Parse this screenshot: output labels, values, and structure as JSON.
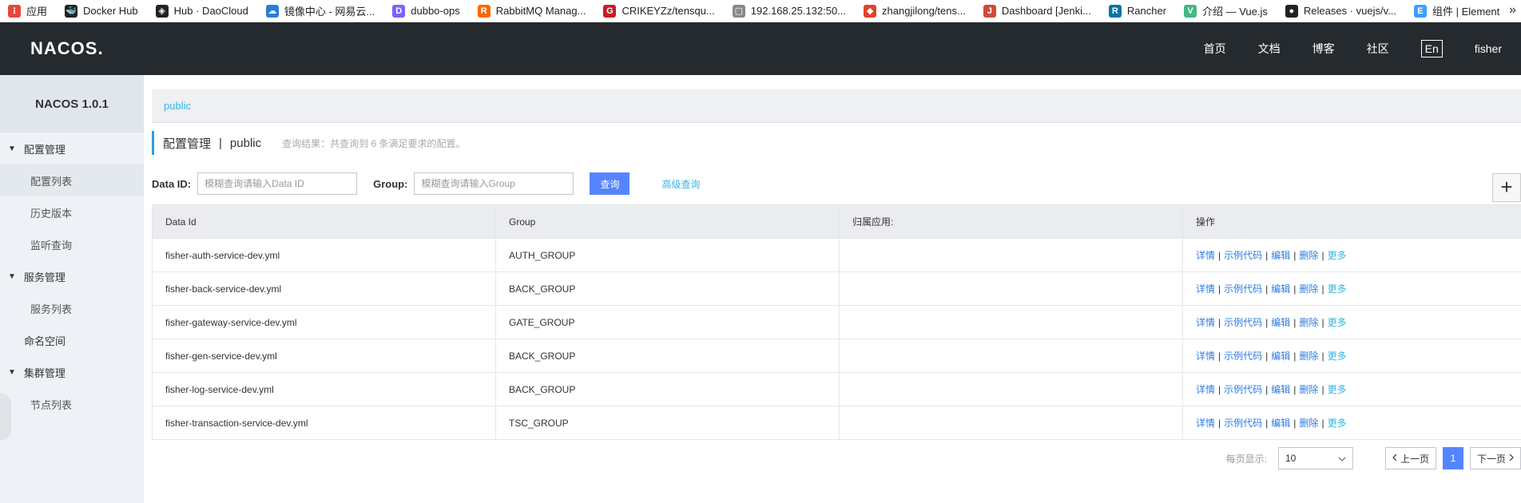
{
  "bookmarks": [
    {
      "label": "应用",
      "icon": "apps-grid-icon",
      "color": "#e8453c"
    },
    {
      "label": "Docker Hub",
      "icon": "docker-icon",
      "color": "#222222"
    },
    {
      "label": "Hub · DaoCloud",
      "icon": "daocloud-icon",
      "color": "#222222"
    },
    {
      "label": "镜像中心 - 网易云...",
      "icon": "cloud-icon",
      "color": "#2a7fd4"
    },
    {
      "label": "dubbo-ops",
      "icon": "dubbo-icon",
      "color": "#7b61ff"
    },
    {
      "label": "RabbitMQ Manag...",
      "icon": "rabbitmq-icon",
      "color": "#f60"
    },
    {
      "label": "CRIKEYZz/tensqu...",
      "icon": "gitee-icon",
      "color": "#c71d23"
    },
    {
      "label": "192.168.25.132:50...",
      "icon": "page-icon",
      "color": "#888888"
    },
    {
      "label": "zhangjilong/tens...",
      "icon": "git-icon",
      "color": "#e24329"
    },
    {
      "label": "Dashboard [Jenki...",
      "icon": "jenkins-icon",
      "color": "#d24939"
    },
    {
      "label": "Rancher",
      "icon": "rancher-icon",
      "color": "#0075a8"
    },
    {
      "label": "介绍 — Vue.js",
      "icon": "vue-icon",
      "color": "#42b883"
    },
    {
      "label": "Releases · vuejs/v...",
      "icon": "github-icon",
      "color": "#222222"
    },
    {
      "label": "组件 | Element",
      "icon": "element-icon",
      "color": "#409eff"
    }
  ],
  "bookmarks_more": "»",
  "header": {
    "logo": "NACOS.",
    "nav": [
      "首页",
      "文档",
      "博客",
      "社区"
    ],
    "lang": "En",
    "user": "fisher"
  },
  "sidebar": {
    "title": "NACOS 1.0.1",
    "groups": [
      {
        "label": "配置管理",
        "items": [
          "配置列表",
          "历史版本",
          "监听查询"
        ]
      },
      {
        "label": "服务管理",
        "items": [
          "服务列表"
        ]
      },
      {
        "label": "命名空间",
        "items": []
      },
      {
        "label": "集群管理",
        "items": [
          "节点列表"
        ]
      }
    ]
  },
  "namespace_tab": "public",
  "page": {
    "title": "配置管理",
    "separator": "|",
    "namespace": "public",
    "hint": "查询结果：共查询到 6 条满足要求的配置。"
  },
  "search": {
    "dataid_label": "Data ID:",
    "dataid_placeholder": "模糊查询请输入Data ID",
    "group_label": "Group:",
    "group_placeholder": "模糊查询请输入Group",
    "query_button": "查询",
    "advanced_link": "高级查询",
    "add_button": "+"
  },
  "table": {
    "columns": [
      "Data Id",
      "Group",
      "归属应用:",
      "操作"
    ],
    "rows": [
      {
        "data_id": "fisher-auth-service-dev.yml",
        "group": "AUTH_GROUP",
        "app": ""
      },
      {
        "data_id": "fisher-back-service-dev.yml",
        "group": "BACK_GROUP",
        "app": ""
      },
      {
        "data_id": "fisher-gateway-service-dev.yml",
        "group": "GATE_GROUP",
        "app": ""
      },
      {
        "data_id": "fisher-gen-service-dev.yml",
        "group": "BACK_GROUP",
        "app": ""
      },
      {
        "data_id": "fisher-log-service-dev.yml",
        "group": "BACK_GROUP",
        "app": ""
      },
      {
        "data_id": "fisher-transaction-service-dev.yml",
        "group": "TSC_GROUP",
        "app": ""
      }
    ],
    "actions": [
      "详情",
      "示例代码",
      "编辑",
      "删除",
      "更多"
    ],
    "action_separator": "|"
  },
  "pagination": {
    "page_size_label": "每页显示:",
    "page_size": "10",
    "prev": "上一页",
    "current": "1",
    "next": "下一页"
  }
}
